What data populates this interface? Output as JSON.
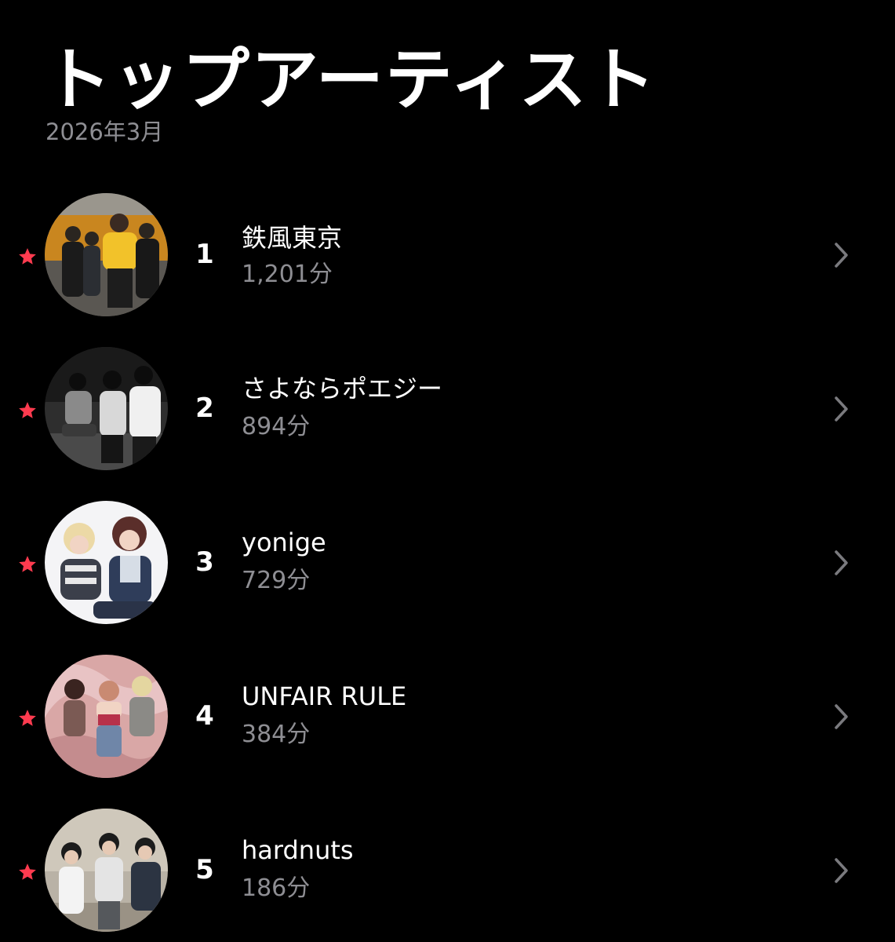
{
  "header": {
    "title": "トップアーティスト",
    "period": "2026年3月"
  },
  "colors": {
    "background": "#000000",
    "accent_star": "#ff3b4f",
    "secondary_text": "#8e8e93",
    "chevron": "#7a7a7e"
  },
  "icons": {
    "star": "star-icon",
    "chevron": "chevron-right-icon"
  },
  "artists": [
    {
      "rank": "1",
      "name": "鉄風東京",
      "minutes": "1,201分"
    },
    {
      "rank": "2",
      "name": "さよならポエジー",
      "minutes": "894分"
    },
    {
      "rank": "3",
      "name": "yonige",
      "minutes": "729分"
    },
    {
      "rank": "4",
      "name": "UNFAIR RULE",
      "minutes": "384分"
    },
    {
      "rank": "5",
      "name": "hardnuts",
      "minutes": "186分"
    }
  ]
}
